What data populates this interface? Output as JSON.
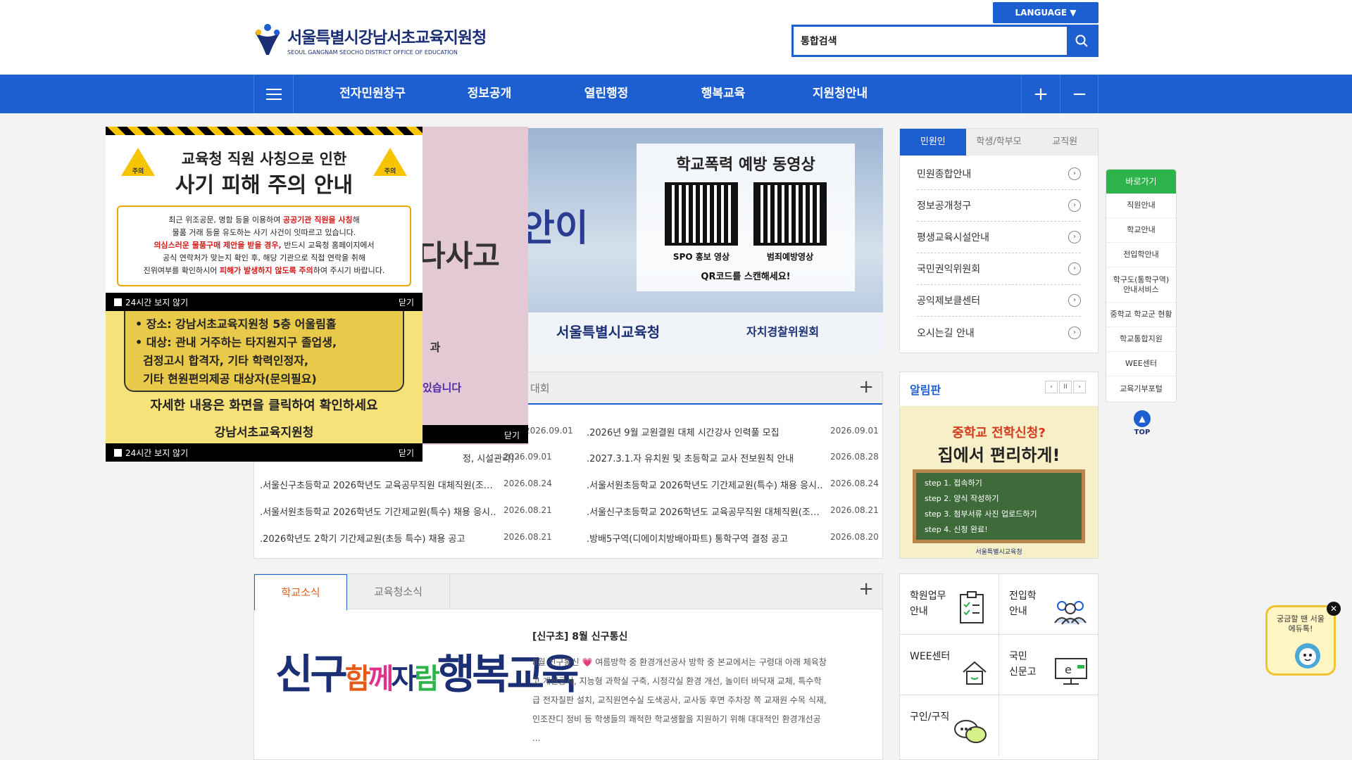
{
  "header": {
    "org_name": "서울특별시강남서초교육지원청",
    "org_name_en": "SEOUL GANGNAM SEOCHO DISTRICT OFFICE OF EDUCATION",
    "language_label": "LANGUAGE ▼",
    "search_value": "통합검색"
  },
  "nav": {
    "items": [
      "전자민원창구",
      "정보공개",
      "열린행정",
      "행복교육",
      "지원청안내"
    ],
    "plus": "+",
    "minus": "−"
  },
  "visual": {
    "left_text": "다사고",
    "big_text": "안이",
    "qr_title": "학교폭력 예방 동영상",
    "qr_cap1": "SPO 홍보 영상",
    "qr_cap2": "범죄예방영상",
    "qr_note": "QR코드를 스캔해세요!",
    "foot_org": "서울특별시교육청",
    "foot_org2": "자치경찰위원회"
  },
  "side_tabs": {
    "tabs": [
      "민원인",
      "학생/학부모",
      "교직원"
    ],
    "items": [
      "민원종합안내",
      "정보공개청구",
      "평생교육시설안내",
      "국민권익위원회",
      "공익제보클센터",
      "오시는길 안내"
    ]
  },
  "quick": {
    "title": "바로가기",
    "items": [
      "직원안내",
      "학교안내",
      "전입학안내",
      "학구도(통학구역)\n안내서비스",
      "중학교 학교군 현황",
      "학교통합지원",
      "WEE센터",
      "교육기부포털"
    ],
    "top": "TOP"
  },
  "board": {
    "tab_visible": "대회",
    "plus": "+",
    "rows_left": [
      {
        "title": "",
        "date": "2026.09.01"
      },
      {
        "title": "정, 시설관리) 인…",
        "date": "2026.09.01"
      },
      {
        "title": ".서울신구초등학교 2026학년도 교육공무직원 대체직원(조…",
        "date": "2026.08.24"
      },
      {
        "title": ".서울서원초등학교 2026학년도 기간제교원(특수) 채용 응시…",
        "date": "2026.08.21"
      },
      {
        "title": ".2026학년도 2학기 기간제교원(초등 특수) 채용 공고",
        "date": "2026.08.21"
      }
    ],
    "rows_right": [
      {
        "title": ".2026년 9월 교원결원 대체 시간강사 인력풀 모집",
        "date": "2026.09.01"
      },
      {
        "title": ".2027.3.1.자 유치원 및 초등학교 교사 전보원칙 안내",
        "date": "2026.08.28"
      },
      {
        "title": ".서울서원초등학교 2026학년도 기간제교원(특수) 채용 응시…",
        "date": "2026.08.24"
      },
      {
        "title": ".서울신구초등학교 2026학년도 교육공무직원 대체직원(조…",
        "date": "2026.08.21"
      },
      {
        "title": ".방배5구역(디에이치방배아파트) 통학구역 결정 공고",
        "date": "2026.08.20"
      }
    ]
  },
  "notice": {
    "title": "알림판",
    "prev": "‹",
    "pause": "II",
    "next": "›",
    "h1": "중학교 전학신청?",
    "h2": "집에서 편리하게!",
    "steps": [
      "step 1. 접속하기",
      "step 2. 양식 작성하기",
      "step 3. 첨부서류 사진 업로드하기",
      "step 4. 신청 완료!"
    ],
    "footer": "서울특별시교육청"
  },
  "news": {
    "tabs": [
      "학교소식",
      "교육청소식"
    ],
    "plus": "+",
    "image_text": [
      "신구",
      "함",
      "께",
      "자",
      "람",
      "행복교육"
    ],
    "title": "[신구초] 8월 신구통신",
    "body": "8월 신구통신 💗 여름방학 중 환경개선공사 방학 중 본교에서는 구령대 아래 체육창고 개선공사, 지능형 과학실 구축, 시청각실 환경 개선, 놀이터 바닥재 교체, 특수학급 전자칠판 설치, 교직원연수실 도색공사, 교사동 후면 주차장 쪽 교재원 수목 식재, 인조잔디 정비 등 학생들의 쾌적한 학교생활을 지원하기 위해 대대적인 환경개선공 ..."
  },
  "grid": {
    "items": [
      "학원업무\n안내",
      "전입학\n안내",
      "WEE센터",
      "국민\n신문고",
      "구인/구직",
      ""
    ]
  },
  "popup1": {
    "t1": "교육청 직원 사칭으로 인한",
    "t2": "사기 피해 주의 안내",
    "caution": "주의",
    "l1a": "최근 위조공문, 명함 등을 이용하여 ",
    "l1b": "공공기관 직원을 사칭",
    "l1c": "해",
    "l2": "물품 거래 등을 유도하는 사기 사건이 잇따르고 있습니다.",
    "l3a": "의심스러운 물품구매 제안을 받을 경우,",
    "l3b": " 반드시 교육청 홈페이지에서",
    "l4": "공식 연락처가 맞는지 확인 후, 해당 기관으로 직접 연락을 취해",
    "l5a": "진위여부를 확인하시어 ",
    "l5b": "피해가 발생하지 않도록 주의",
    "l5c": "하여 주시기 바랍니다.",
    "check": "24시간 보지 않기",
    "close": "닫기"
  },
  "popup2": {
    "lines": [
      "• 장소: 강남서초교육지원청 5층 어울림홀",
      "• 대상: 관내 거주하는 타지원지구 졸업생,",
      "  검정고시 합격자, 기타 학력인정자,",
      "  기타 현원편의제공 대상자(문의필요)"
    ],
    "l1": "자세한 내용은 화면을 클릭하여 확인하세요",
    "l2": "강남서초교육지원청",
    "check": "24시간 보지 않기",
    "close": "닫기"
  },
  "popup_back": {
    "text1": "과",
    "text2": "있습니다",
    "close": "닫기"
  },
  "float": {
    "text": "궁금할 땐 서울에듀톡!",
    "close": "✕"
  }
}
